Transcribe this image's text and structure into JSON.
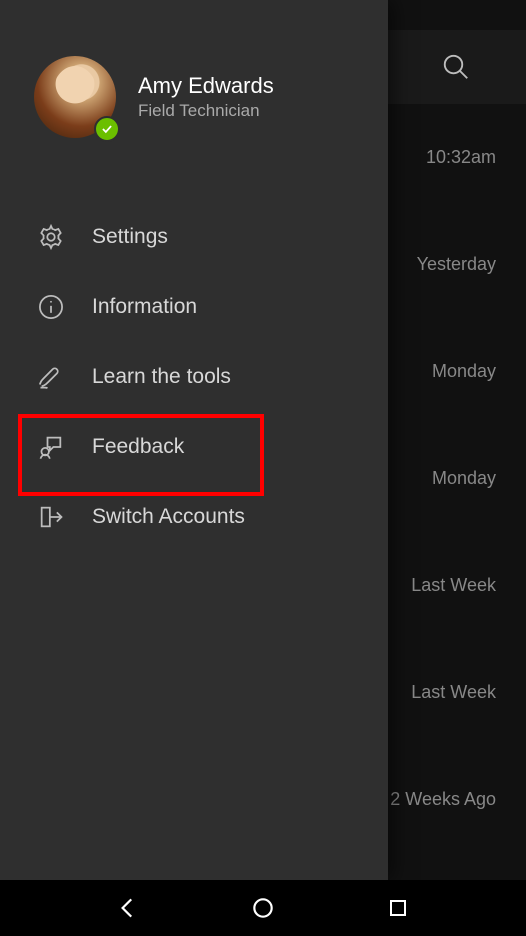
{
  "user": {
    "name": "Amy Edwards",
    "role": "Field Technician",
    "presence": "available"
  },
  "menu": {
    "items": [
      {
        "label": "Settings",
        "icon": "gear-icon"
      },
      {
        "label": "Information",
        "icon": "info-icon"
      },
      {
        "label": "Learn the tools",
        "icon": "pen-icon"
      },
      {
        "label": "Feedback",
        "icon": "feedback-icon"
      },
      {
        "label": "Switch Accounts",
        "icon": "switch-icon"
      }
    ],
    "highlighted_index": 3
  },
  "background": {
    "times": [
      "10:32am",
      "Yesterday",
      "Monday",
      "Monday",
      "Last Week",
      "Last Week",
      "2 Weeks Ago"
    ]
  },
  "navbar": {
    "back": "Back",
    "home": "Home",
    "overview": "Overview"
  }
}
